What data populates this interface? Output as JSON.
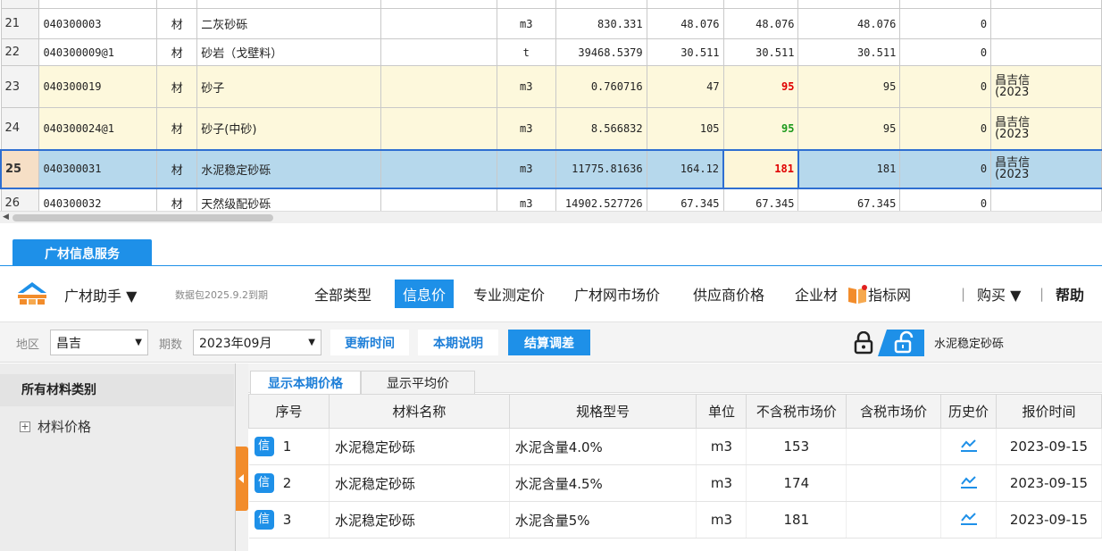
{
  "top_grid": {
    "rows": [
      {
        "n": "21",
        "code": "040300003",
        "type": "材",
        "name": "二灰砂砾",
        "spec": "",
        "unit": "m3",
        "qty": "830.331",
        "p1": "48.076",
        "p2": "48.076",
        "p3": "48.076",
        "diff": "0",
        "note1": "",
        "note2": "",
        "style": "normal"
      },
      {
        "n": "22",
        "code": "040300009@1",
        "type": "材",
        "name": "砂岩（戈壁料）",
        "spec": "",
        "unit": "t",
        "qty": "39468.5379",
        "p1": "30.511",
        "p2": "30.511",
        "p3": "30.511",
        "diff": "0",
        "note1": "",
        "note2": "",
        "style": "normal"
      },
      {
        "n": "23",
        "code": "040300019",
        "type": "材",
        "name": "砂子",
        "spec": "",
        "unit": "m3",
        "qty": "0.760716",
        "p1": "47",
        "p2": "95",
        "p3": "95",
        "diff": "0",
        "note1": "昌吉信",
        "note2": "(2023",
        "style": "yellow",
        "p2color": "red"
      },
      {
        "n": "24",
        "code": "040300024@1",
        "type": "材",
        "name": "砂子(中砂)",
        "spec": "",
        "unit": "m3",
        "qty": "8.566832",
        "p1": "105",
        "p2": "95",
        "p3": "95",
        "diff": "0",
        "note1": "昌吉信",
        "note2": "(2023",
        "style": "yellow",
        "p2color": "green"
      },
      {
        "n": "25",
        "code": "040300031",
        "type": "材",
        "name": "水泥稳定砂砾",
        "spec": "",
        "unit": "m3",
        "qty": "11775.81636",
        "p1": "164.12",
        "p2": "181",
        "p3": "181",
        "diff": "0",
        "note1": "昌吉信",
        "note2": "(2023",
        "style": "sel",
        "p2color": "red"
      },
      {
        "n": "26",
        "code": "040300032",
        "type": "材",
        "name": "天然级配砂砾",
        "spec": "",
        "unit": "m3",
        "qty": "14902.527726",
        "p1": "67.345",
        "p2": "67.345",
        "p3": "67.345",
        "diff": "0",
        "note1": "",
        "note2": "",
        "style": "normal"
      }
    ]
  },
  "panel": {
    "tab_label": "广材信息服务",
    "assistant_label": "广材助手 ▼",
    "datapkg_text": "数据包2025.9.2到期",
    "nav": [
      "全部类型",
      "信息价",
      "专业测定价",
      "广材网市场价",
      "供应商价格",
      "企业材",
      "指标网"
    ],
    "nav_active": "信息价",
    "buy_label": "购买 ▼",
    "help_label": "帮助"
  },
  "filter": {
    "region_label": "地区",
    "region_value": "昌吉",
    "period_label": "期数",
    "period_value": "2023年09月",
    "update_time_label": "更新时间",
    "period_note_label": "本期说明",
    "settle_label": "结算调差",
    "search_value": "水泥稳定砂砾"
  },
  "category": {
    "header": "所有材料类别",
    "item_toggle": "+",
    "item_label": "材料价格"
  },
  "subtabs": {
    "current": "显示本期价格",
    "average": "显示平均价"
  },
  "price_table": {
    "headers": [
      "序号",
      "材料名称",
      "规格型号",
      "单位",
      "不含税市场价",
      "含税市场价",
      "历史价",
      "报价时间"
    ],
    "badge": "信",
    "rows": [
      {
        "seq": "1",
        "name": "水泥稳定砂砾",
        "spec": "水泥含量4.0%",
        "unit": "m3",
        "price_ex": "153",
        "price_in": "",
        "date": "2023-09-15"
      },
      {
        "seq": "2",
        "name": "水泥稳定砂砾",
        "spec": "水泥含量4.5%",
        "unit": "m3",
        "price_ex": "174",
        "price_in": "",
        "date": "2023-09-15"
      },
      {
        "seq": "3",
        "name": "水泥稳定砂砾",
        "spec": "水泥含量5%",
        "unit": "m3",
        "price_ex": "181",
        "price_in": "",
        "date": "2023-09-15"
      }
    ]
  },
  "colors": {
    "accent": "#1e90e8",
    "selected_row": "#b6d8ec",
    "highlight_row": "#fdf8dc",
    "price_up": "#e00000",
    "price_down": "#1c9a1c",
    "handle": "#f28c2b"
  }
}
